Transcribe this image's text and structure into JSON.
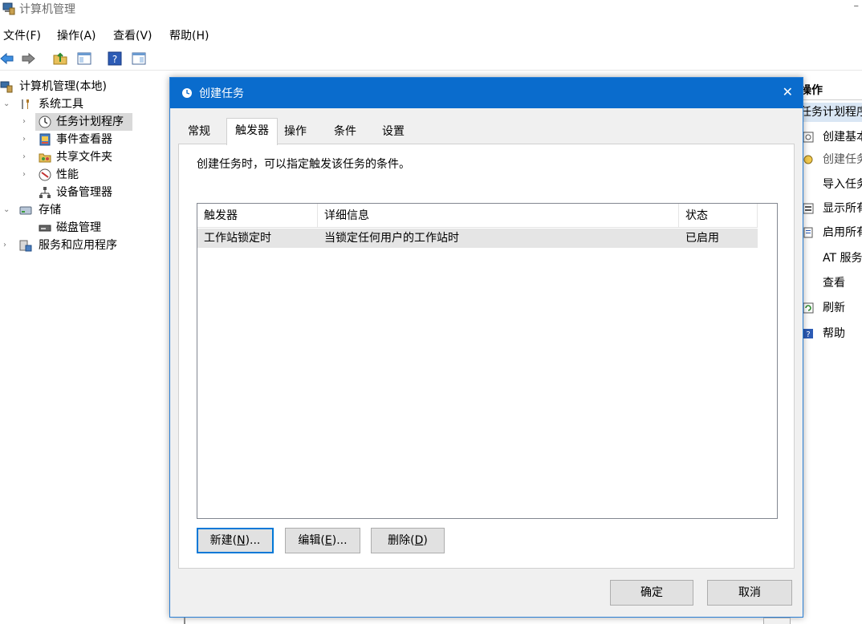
{
  "app": {
    "title": "计算机管理",
    "minimize_glyph": "–"
  },
  "menu": [
    {
      "label": "文件(F)"
    },
    {
      "label": "操作(A)"
    },
    {
      "label": "查看(V)"
    },
    {
      "label": "帮助(H)"
    }
  ],
  "toolbar": {
    "icons": [
      "back-arrow-icon",
      "forward-arrow-icon",
      "up-folder-icon",
      "show-hide-console-tree-icon",
      "help-icon",
      "show-hide-action-pane-icon"
    ]
  },
  "tree": {
    "root": "计算机管理(本地)",
    "system_tools": "系统工具",
    "task_scheduler": "任务计划程序",
    "event_viewer": "事件查看器",
    "shared_folders": "共享文件夹",
    "performance": "性能",
    "device_manager": "设备管理器",
    "storage": "存储",
    "disk_management": "磁盘管理",
    "services_apps": "服务和应用程序"
  },
  "actions": {
    "header": "操作",
    "section": "任务计划程序",
    "items": [
      {
        "label": "创建基本任务..."
      },
      {
        "label": "创建任务..."
      },
      {
        "label": "导入任务..."
      },
      {
        "label": "显示所有正在运行的任务"
      },
      {
        "label": "启用所有任务历史记录"
      },
      {
        "label": "AT 服务帐户配置"
      },
      {
        "label": "查看"
      },
      {
        "label": "刷新"
      },
      {
        "label": "帮助"
      }
    ]
  },
  "dialog": {
    "title": "创建任务",
    "close_glyph": "✕",
    "tabs": [
      {
        "label": "常规"
      },
      {
        "label": "触发器"
      },
      {
        "label": "操作"
      },
      {
        "label": "条件"
      },
      {
        "label": "设置"
      }
    ],
    "description": "创建任务时，可以指定触发该任务的条件。",
    "list": {
      "columns": [
        "触发器",
        "详细信息",
        "状态"
      ],
      "rows": [
        {
          "trigger": "工作站锁定时",
          "details": "当锁定任何用户的工作站时",
          "status": "已启用"
        }
      ]
    },
    "buttons": {
      "new_pre": "新建(",
      "new_key": "N",
      "new_post": ")...",
      "edit_pre": "编辑(",
      "edit_key": "E",
      "edit_post": ")...",
      "delete_pre": "删除(",
      "delete_key": "D",
      "delete_post": ")",
      "ok": "确定",
      "cancel": "取消"
    }
  },
  "colors": {
    "dialog_title_bg": "#0a6ccd",
    "dialog_border": "#2b7fd4",
    "selection_gray": "#e5e5e5",
    "focus_blue": "#0078d7"
  }
}
